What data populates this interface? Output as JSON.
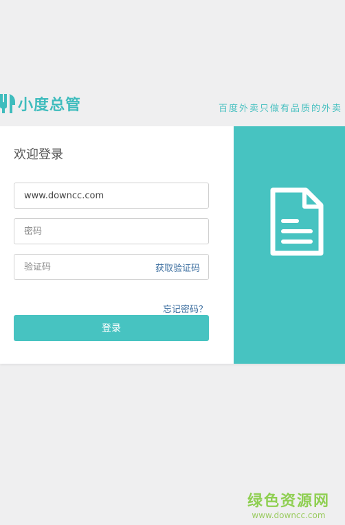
{
  "header": {
    "logo_text": "小度总管",
    "slogan": "百度外卖只做有品质的外卖"
  },
  "login": {
    "title": "欢迎登录",
    "username_value": "www.downcc.com",
    "password_placeholder": "密码",
    "captcha_placeholder": "验证码",
    "get_code_label": "获取验证码",
    "forgot_label": "忘记密码？",
    "submit_label": "登录"
  },
  "side_panel": {
    "icon": "document-icon",
    "color": "#47c3c1"
  },
  "watermark": {
    "title": "绿色资源网",
    "url": "www.downcc.com"
  },
  "colors": {
    "accent": "#47c3c1",
    "link": "#3d6fa0",
    "watermark": "#8fcf52"
  }
}
